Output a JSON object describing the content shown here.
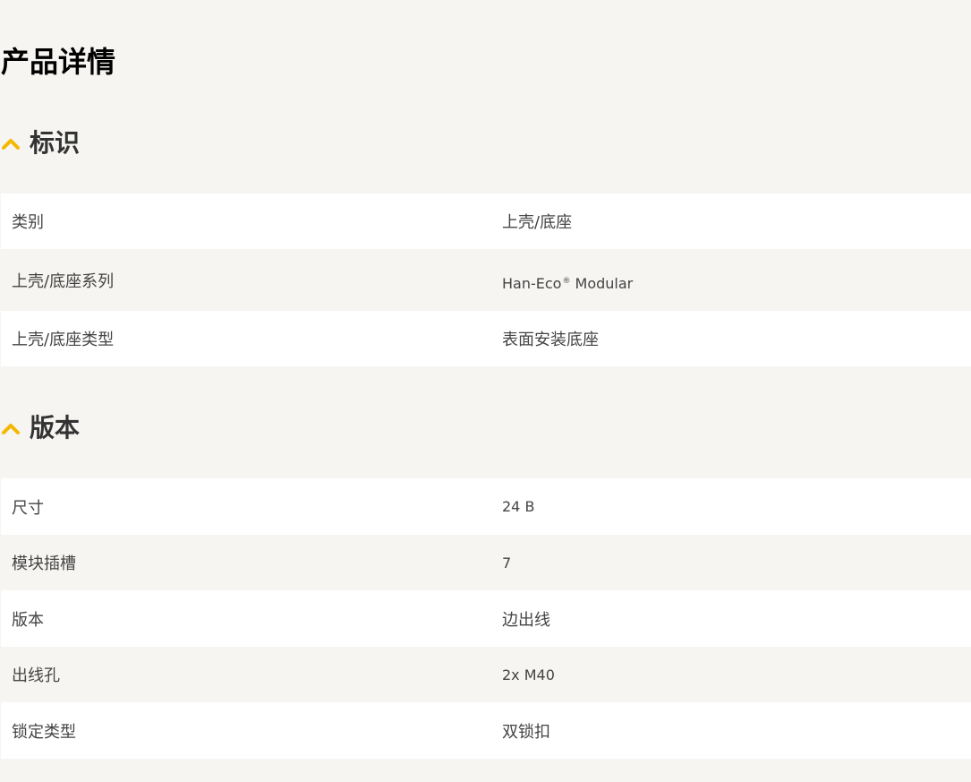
{
  "page": {
    "title": "产品详情"
  },
  "sections": [
    {
      "title": "标识",
      "icon": "chevron-up-icon",
      "rows": [
        {
          "label": "类别",
          "value": "上壳/底座"
        },
        {
          "label": "上壳/底座系列",
          "value_main": "Han-Eco",
          "value_sup": "®",
          "value_rest": " Modular"
        },
        {
          "label": "上壳/底座类型",
          "value": "表面安装底座"
        }
      ]
    },
    {
      "title": "版本",
      "icon": "chevron-up-icon",
      "rows": [
        {
          "label": "尺寸",
          "value": "24 B"
        },
        {
          "label": "模块插槽",
          "value": "7"
        },
        {
          "label": "版本",
          "value": "边出线"
        },
        {
          "label": "出线孔",
          "value": "2x M40"
        },
        {
          "label": "锁定类型",
          "value": "双锁扣"
        }
      ]
    }
  ],
  "colors": {
    "accent": "#f5b800",
    "background": "#f6f5f2",
    "row_white": "#ffffff"
  }
}
